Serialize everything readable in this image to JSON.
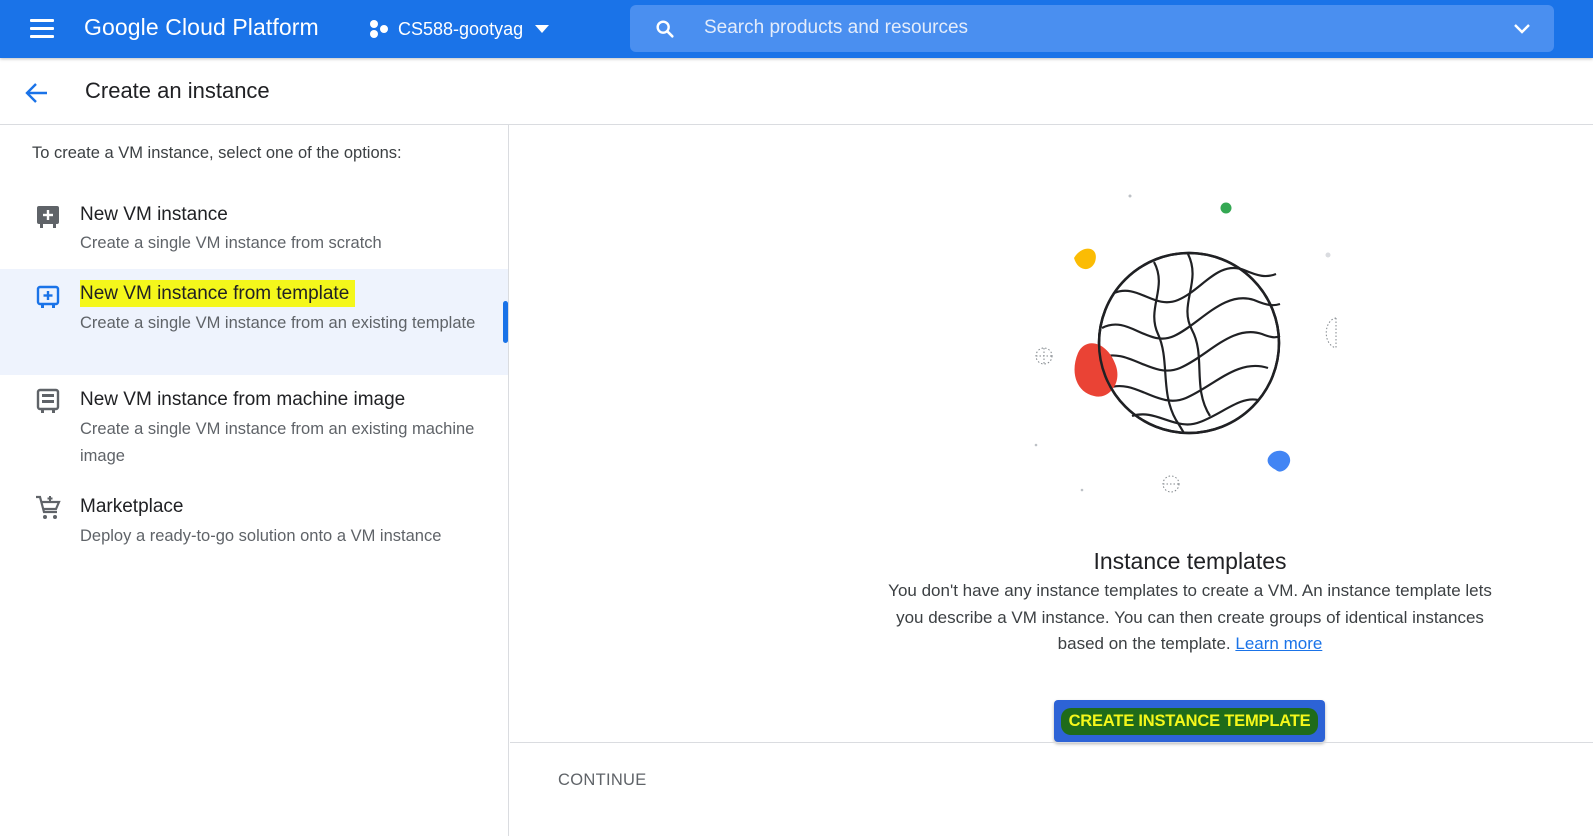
{
  "topbar": {
    "brand": "Google Cloud Platform",
    "project_name": "CS588-gootyag",
    "search_placeholder": "Search products and resources",
    "accent": "#1a73e8"
  },
  "header": {
    "title": "Create an instance"
  },
  "left": {
    "intro": "To create a VM instance, select one of the options:",
    "options": [
      {
        "title": "New VM instance",
        "desc": "Create a single VM instance from scratch",
        "icon": "add-box-icon"
      },
      {
        "title": "New VM instance from template",
        "desc": "Create a single VM instance from an existing template",
        "icon": "add-box-outline-icon",
        "selected": true
      },
      {
        "title": "New VM instance from machine image",
        "desc": "Create a single VM instance from an existing machine image",
        "icon": "machine-image-icon"
      },
      {
        "title": "Marketplace",
        "desc": "Deploy a ready-to-go solution onto a VM instance",
        "icon": "cart-icon"
      }
    ]
  },
  "right": {
    "empty_title": "Instance templates",
    "empty_text": "You don't have any instance templates to create a VM. An instance template lets you describe a VM instance. You can then create groups of identical instances based on the template.",
    "learn_more": "Learn more",
    "create_button": "CREATE INSTANCE TEMPLATE",
    "highlight_color": "#f4f71b"
  },
  "footer": {
    "continue_label": "CONTINUE"
  }
}
